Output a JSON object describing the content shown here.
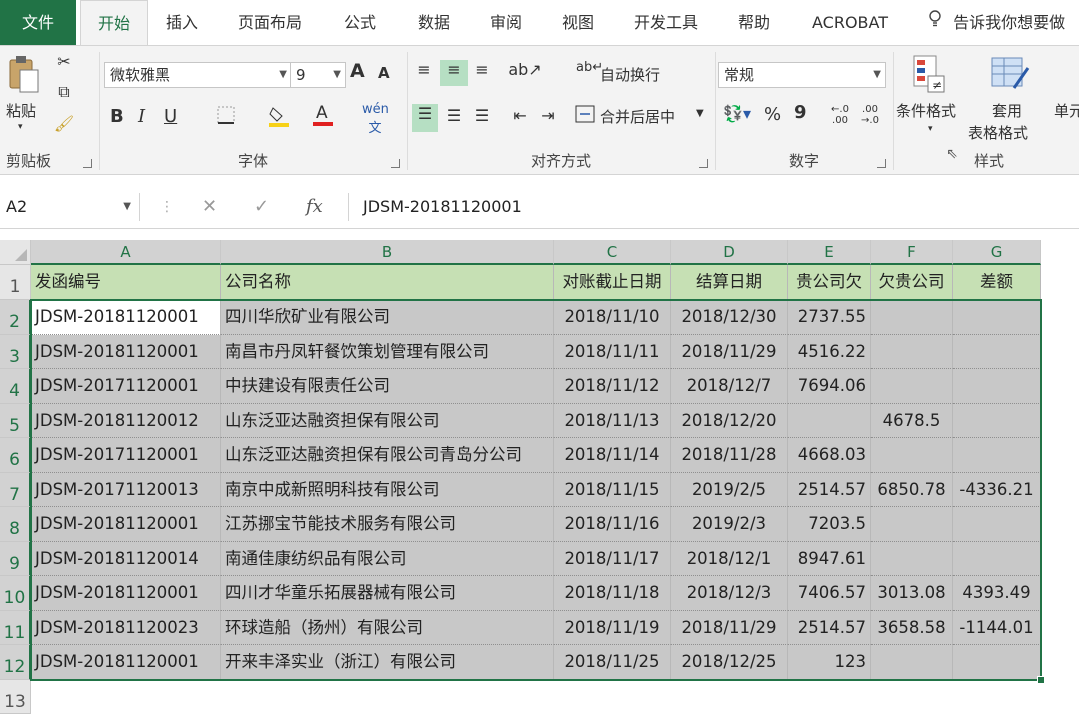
{
  "tabs": [
    "文件",
    "开始",
    "插入",
    "页面布局",
    "公式",
    "数据",
    "审阅",
    "视图",
    "开发工具",
    "帮助",
    "ACROBAT"
  ],
  "tell_me": "告诉我你想要做",
  "ribbon": {
    "clipboard": {
      "paste": "粘贴",
      "label": "剪贴板"
    },
    "font": {
      "name": "微软雅黑",
      "size": "9",
      "bold": "B",
      "italic": "I",
      "underline": "U",
      "label": "字体",
      "grow": "A",
      "shrink": "A"
    },
    "alignment": {
      "wrap": "自动换行",
      "merge": "合并后居中",
      "label": "对齐方式"
    },
    "number": {
      "format": "常规",
      "percent": "%",
      "comma": "9",
      "label": "数字"
    },
    "styles": {
      "conditional": "条件格式",
      "table_l1": "套用",
      "table_l2": "表格格式",
      "cell_styles": "单元",
      "label": "样式"
    }
  },
  "formula_bar": {
    "name_box": "A2",
    "fx": "fx",
    "value": "JDSM-20181120001"
  },
  "columns": [
    "A",
    "B",
    "C",
    "D",
    "E",
    "F",
    "G"
  ],
  "rows": [
    "1",
    "2",
    "3",
    "4",
    "5",
    "6",
    "7",
    "8",
    "9",
    "10",
    "11",
    "12",
    "13"
  ],
  "header_row": [
    "发函编号",
    "公司名称",
    "对账截止日期",
    "结算日期",
    "贵公司欠",
    "欠贵公司",
    "差额"
  ],
  "table": [
    [
      "JDSM-20181120001",
      "四川华欣矿业有限公司",
      "2018/11/10",
      "2018/12/30",
      "2737.55",
      "",
      ""
    ],
    [
      "JDSM-20181120001",
      "南昌市丹凤轩餐饮策划管理有限公司",
      "2018/11/11",
      "2018/11/29",
      "4516.22",
      "",
      ""
    ],
    [
      "JDSM-20171120001",
      "中扶建设有限责任公司",
      "2018/11/12",
      "2018/12/7",
      "7694.06",
      "",
      ""
    ],
    [
      "JDSM-20181120012",
      "山东泛亚达融资担保有限公司",
      "2018/11/13",
      "2018/12/20",
      "",
      "4678.5",
      ""
    ],
    [
      "JDSM-20171120001",
      "山东泛亚达融资担保有限公司青岛分公司",
      "2018/11/14",
      "2018/11/28",
      "4668.03",
      "",
      ""
    ],
    [
      "JDSM-20171120013",
      "南京中成新照明科技有限公司",
      "2018/11/15",
      "2019/2/5",
      "2514.57",
      "6850.78",
      "-4336.21"
    ],
    [
      "JDSM-20181120001",
      "江苏挪宝节能技术服务有限公司",
      "2018/11/16",
      "2019/2/3",
      "7203.5",
      "",
      ""
    ],
    [
      "JDSM-20181120014",
      "南通佳康纺织品有限公司",
      "2018/11/17",
      "2018/12/1",
      "8947.61",
      "",
      ""
    ],
    [
      "JDSM-20181120001",
      "四川才华童乐拓展器械有限公司",
      "2018/11/18",
      "2018/12/3",
      "7406.57",
      "3013.08",
      "4393.49"
    ],
    [
      "JDSM-20181120023",
      "环球造船（扬州）有限公司",
      "2018/11/19",
      "2018/11/29",
      "2514.57",
      "3658.58",
      "-1144.01"
    ],
    [
      "JDSM-20181120001",
      "开来丰泽实业（浙江）有限公司",
      "2018/11/25",
      "2018/12/25",
      "123",
      "",
      ""
    ]
  ],
  "colors": {
    "excel_green": "#217346",
    "header_fill": "#c6e0b4",
    "selection_fill": "#c8c8c8"
  }
}
